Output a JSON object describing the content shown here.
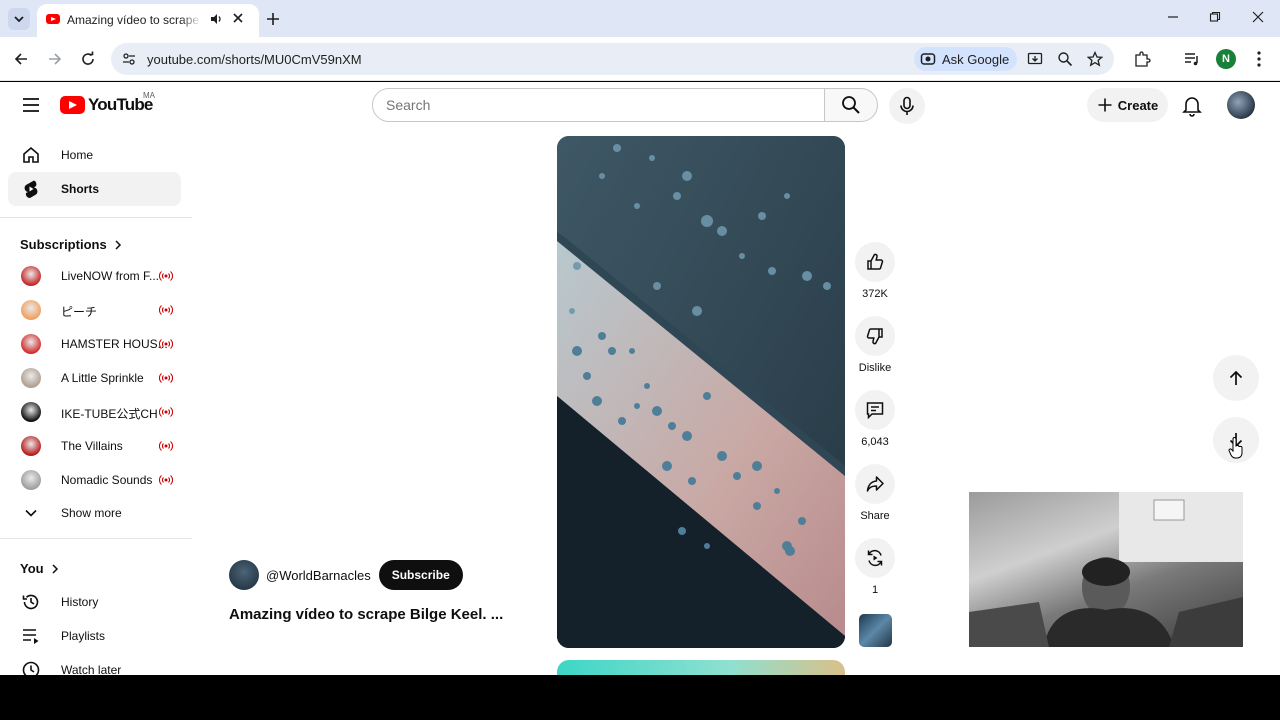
{
  "browser": {
    "tab_title": "Amazing vídeo to scrape Bilge Keel",
    "url": "youtube.com/shorts/MU0CmV59nXM",
    "ask_google": "Ask Google",
    "profile_initial": "N"
  },
  "masthead": {
    "logo_text": "YouTube",
    "country_code": "MA",
    "search_placeholder": "Search",
    "create_label": "Create"
  },
  "sidebar": {
    "main": [
      {
        "label": "Home",
        "icon": "home-icon"
      },
      {
        "label": "Shorts",
        "icon": "shorts-icon",
        "active": true
      }
    ],
    "subscriptions_title": "Subscriptions",
    "subscriptions": [
      {
        "label": "LiveNOW from F...",
        "live": true,
        "color": "#c62828"
      },
      {
        "label": "ピーチ",
        "live": true,
        "color": "#f0a060"
      },
      {
        "label": "HAMSTER HOUS...",
        "live": true,
        "color": "#d32f2f"
      },
      {
        "label": "A Little Sprinkle",
        "live": true,
        "color": "#b0a090"
      },
      {
        "label": "IKE-TUBE公式CH",
        "live": true,
        "color": "#111111"
      },
      {
        "label": "The Villains",
        "live": true,
        "color": "#b71c1c"
      },
      {
        "label": "Nomadic Sounds",
        "live": true,
        "color": "#9e9e9e"
      }
    ],
    "show_more": "Show more",
    "you_title": "You",
    "you_items": [
      {
        "label": "History",
        "icon": "history-icon"
      },
      {
        "label": "Playlists",
        "icon": "playlists-icon"
      },
      {
        "label": "Watch later",
        "icon": "watch-later-icon"
      }
    ]
  },
  "short": {
    "channel": "@WorldBarnacles",
    "subscribe_label": "Subscribe",
    "title": "Amazing vídeo to scrape Bilge Keel. ...",
    "likes": "372K",
    "dislike_label": "Dislike",
    "comments": "6,043",
    "share_label": "Share",
    "remix_count": "1"
  },
  "colors": {
    "youtube_red": "#ff0000",
    "live_red": "#cc0000",
    "subscribe_bg": "#0f0f0f"
  }
}
